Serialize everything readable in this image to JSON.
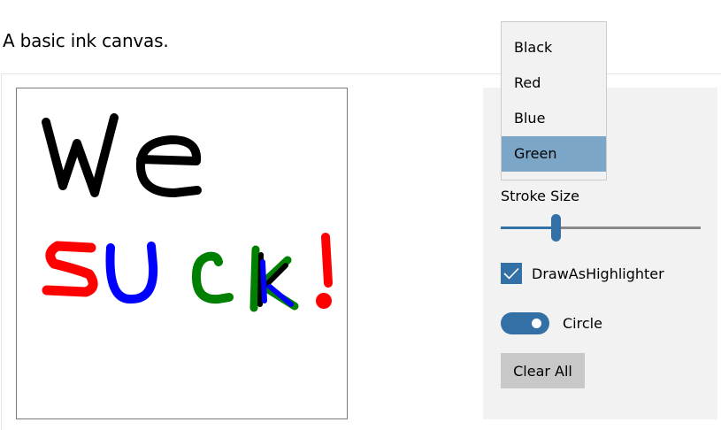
{
  "header": {
    "description": "A basic ink canvas."
  },
  "color_menu": {
    "items": [
      "Black",
      "Red",
      "Blue",
      "Green"
    ],
    "selected": "Green"
  },
  "stroke_size": {
    "label": "Stroke Size",
    "value_fraction": 0.27
  },
  "highlighter": {
    "label": "DrawAsHighlighter",
    "checked": true
  },
  "pen_tip": {
    "label": "Circle",
    "on": true
  },
  "clear_button": {
    "label": "Clear All"
  },
  "colors": {
    "accent": "#3370a5",
    "selected_item": "#7ba6c7",
    "panel": "#f2f2f2",
    "button": "#c8c8c8",
    "ink_black": "#000000",
    "ink_red": "#ff0000",
    "ink_blue": "#0000ff",
    "ink_green": "#008000"
  }
}
